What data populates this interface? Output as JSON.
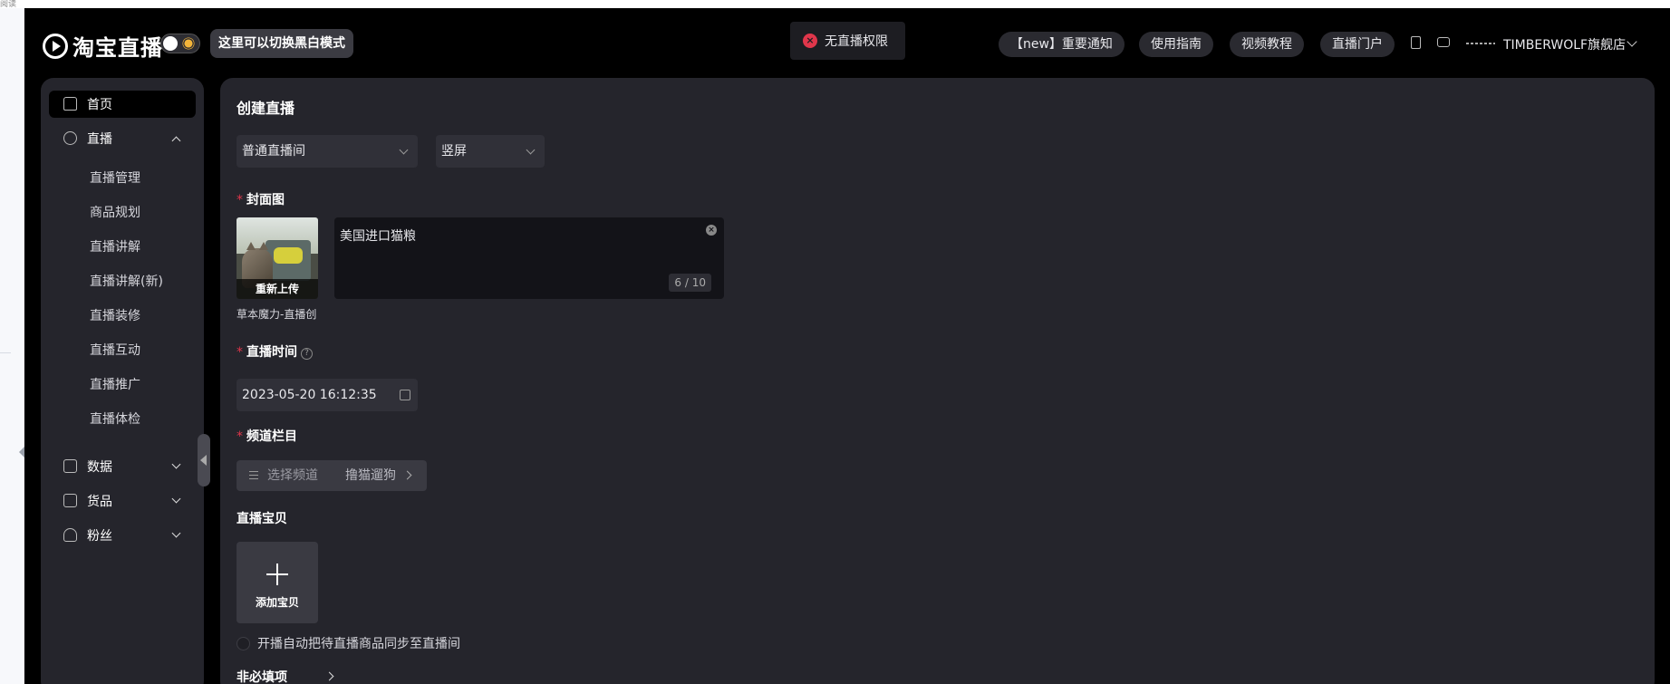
{
  "browser": {
    "corner_label": "阅读"
  },
  "header": {
    "logo_text": "淘宝直播",
    "mode_button": "这里可以切换黑白模式",
    "toast": "无直播权限",
    "links": [
      "【new】重要通知",
      "使用指南",
      "视频教程",
      "直播门户"
    ],
    "shop_name": "TIMBERWOLF旗舰店"
  },
  "sidebar": {
    "home": "首页",
    "live": "直播",
    "live_sub": [
      "直播管理",
      "商品规划",
      "直播讲解",
      "直播讲解(新)",
      "直播装修",
      "直播互动",
      "直播推广",
      "直播体检"
    ],
    "data": "数据",
    "goods": "货品",
    "fans": "粉丝"
  },
  "main": {
    "title": "创建直播",
    "room_type": "普通直播间",
    "orientation": "竖屏",
    "cover_label": "封面图",
    "cover_reupload": "重新上传",
    "cover_caption": "草本魔力-直播创",
    "live_title": "美国进口猫粮",
    "title_count": "6 / 10",
    "time_label": "直播时间",
    "time_value": "2023-05-20 16:12:35",
    "channel_label": "频道栏目",
    "channel_placeholder": "选择频道",
    "channel_value": "撸猫遛狗",
    "items_label": "直播宝贝",
    "add_item": "添加宝贝",
    "sync_text": "开播自动把待直播商品同步至直播间",
    "optional": "非必填项"
  },
  "colors": {
    "accent_error": "#e0364b",
    "panel": "#25252c",
    "background": "#000000"
  },
  "icons": [
    "home-icon",
    "live-icon",
    "data-icon",
    "goods-icon",
    "fans-icon",
    "doc-icon",
    "chat-icon",
    "calendar-icon",
    "error-icon",
    "help-icon"
  ]
}
